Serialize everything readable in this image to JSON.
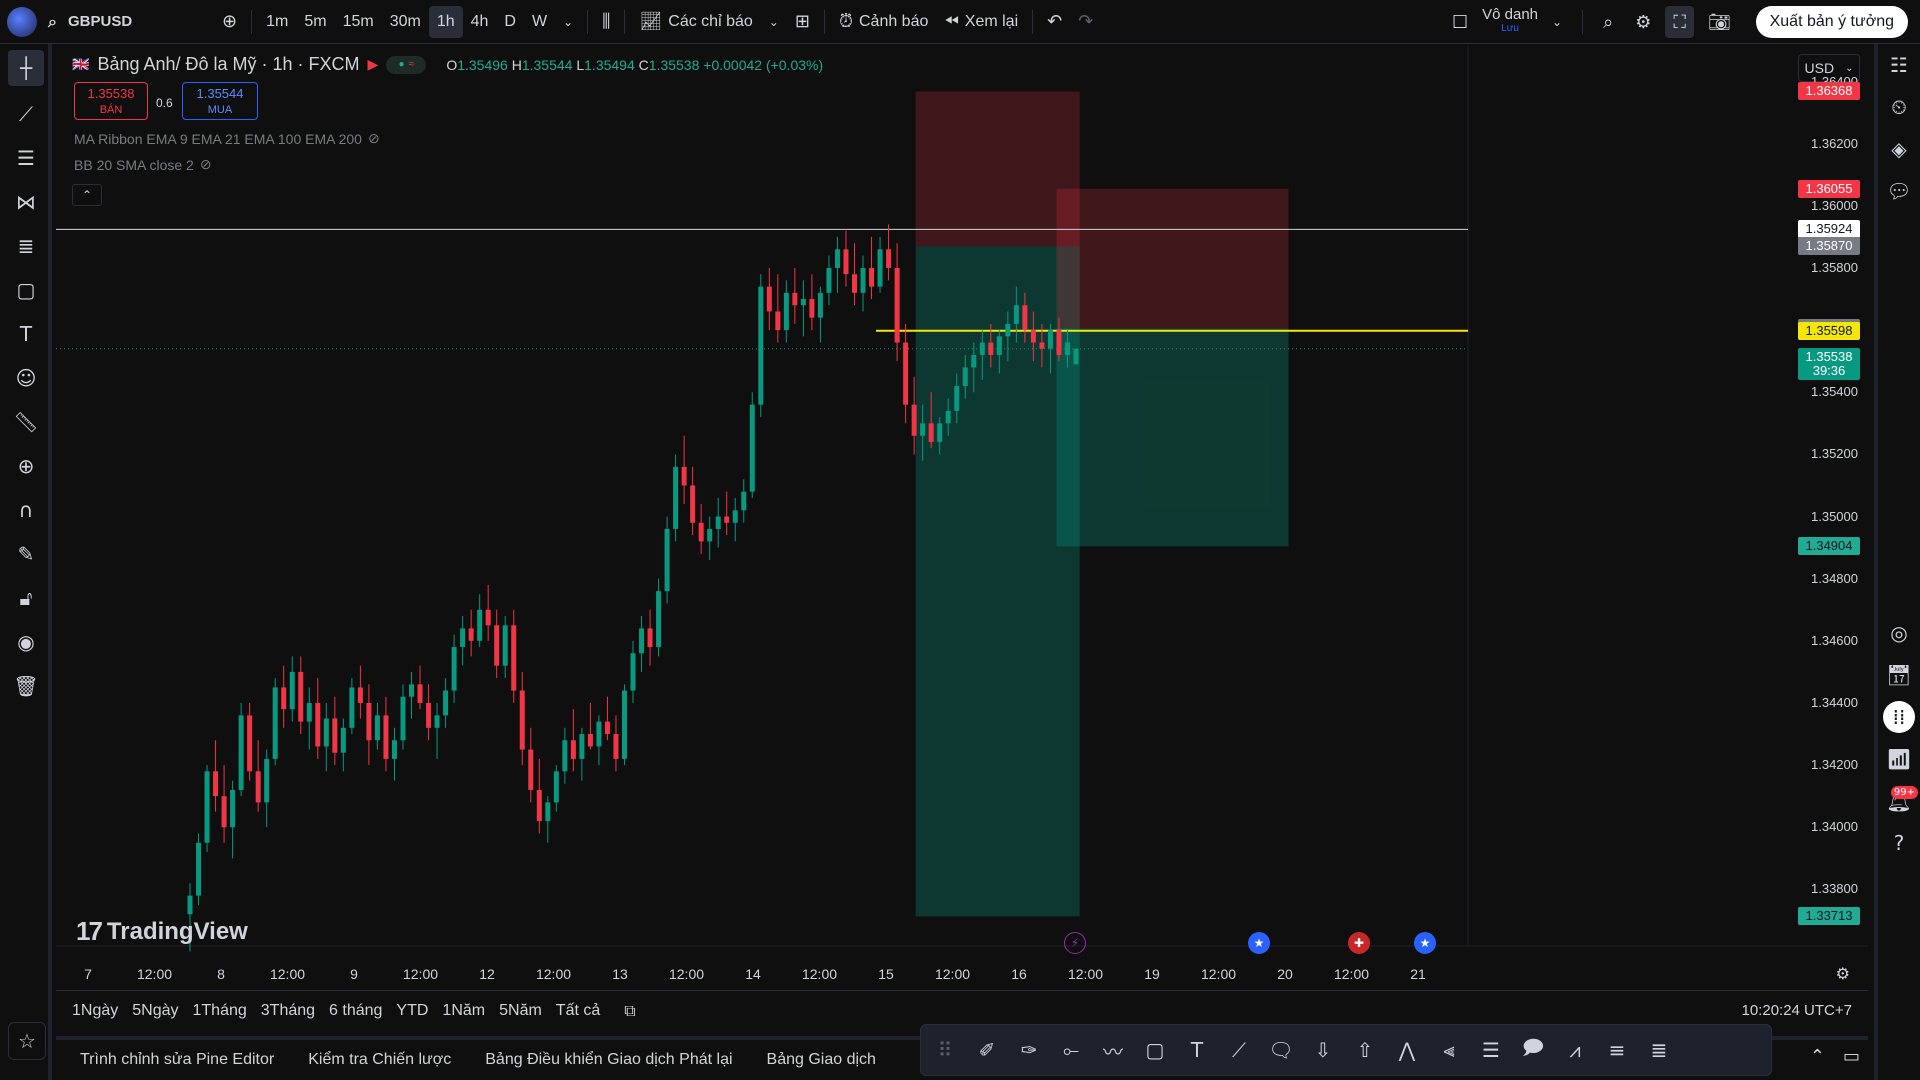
{
  "topbar": {
    "symbol": "GBPUSD",
    "intervals": [
      "1m",
      "5m",
      "15m",
      "30m",
      "1h",
      "4h",
      "D",
      "W"
    ],
    "active_interval": "1h",
    "indicators_label": "Các chỉ báo",
    "alert_label": "Cảnh báo",
    "replay_label": "Xem lại",
    "layout_name": "Vô danh",
    "layout_sub": "Lưu",
    "publish_label": "Xuất bản ý tưởng"
  },
  "legend": {
    "title": "Bảng Anh/ Đô la Mỹ · 1h · FXCM",
    "o_label": "O",
    "o": "1.35496",
    "h_label": "H",
    "h": "1.35544",
    "l_label": "L",
    "l": "1.35494",
    "c_label": "C",
    "c": "1.35538",
    "change": "+0.00042 (+0.03%)",
    "sell_price": "1.35538",
    "sell_label": "BÁN",
    "buy_price": "1.35544",
    "buy_label": "MUA",
    "spread": "0.6",
    "indicator1": "MA Ribbon EMA 9 EMA 21 EMA 100 EMA 200",
    "indicator2": "BB 20 SMA close 2",
    "currency": "USD"
  },
  "price_axis": {
    "ticks": [
      "1.36400",
      "1.36200",
      "1.36000",
      "1.35800",
      "1.35400",
      "1.35200",
      "1.35000",
      "1.34800",
      "1.34600",
      "1.34400",
      "1.34200",
      "1.34000",
      "1.33800"
    ],
    "labels": [
      {
        "text": "1.36368",
        "bg": "#f23645",
        "fg": "#ffffff"
      },
      {
        "text": "1.36055",
        "bg": "#f23645",
        "fg": "#ffffff"
      },
      {
        "text": "1.35924",
        "bg": "#ffffff",
        "fg": "#131722"
      },
      {
        "text": "1.35870",
        "bg": "#787b86",
        "fg": "#ffffff"
      },
      {
        "text": "1.35607",
        "bg": "#787b86",
        "fg": "#ffffff"
      },
      {
        "text": "1.35598",
        "bg": "#f5e60a",
        "fg": "#131722"
      },
      {
        "text": "1.35538",
        "bg": "#089981",
        "fg": "#ffffff"
      },
      {
        "text": "1.34904",
        "bg": "#22ab94",
        "fg": "#131722"
      },
      {
        "text": "1.33713",
        "bg": "#22ab94",
        "fg": "#131722"
      }
    ],
    "countdown": "39:36"
  },
  "time_axis": [
    "7",
    "12:00",
    "8",
    "12:00",
    "9",
    "12:00",
    "12",
    "12:00",
    "13",
    "12:00",
    "14",
    "12:00",
    "15",
    "12:00",
    "16",
    "12:00",
    "19",
    "12:00",
    "20",
    "12:00",
    "21"
  ],
  "ranges": [
    "1Ngày",
    "5Ngày",
    "1Tháng",
    "3Tháng",
    "6 tháng",
    "YTD",
    "1Năm",
    "5Năm",
    "Tất cả"
  ],
  "clock": "10:20:24 UTC+7",
  "bottom_tabs": [
    "Trình chỉnh sửa Pine Editor",
    "Kiểm tra Chiến lược",
    "Bảng Điều khiển Giao dịch Phát lại",
    "Bảng Giao dịch"
  ],
  "watermark": "TradingView",
  "notifications_badge": "99+",
  "colors": {
    "up": "#089981",
    "down": "#f23645",
    "bg": "#0f0f0f",
    "line_yellow": "#f5e60a"
  },
  "chart_data": {
    "type": "candlestick",
    "ylim": [
      1.3365,
      1.3645
    ],
    "x": "bars",
    "candles": [
      [
        1.3372,
        1.3382,
        1.336,
        1.3378
      ],
      [
        1.3378,
        1.3398,
        1.3375,
        1.3395
      ],
      [
        1.3395,
        1.342,
        1.3392,
        1.3418
      ],
      [
        1.3418,
        1.3428,
        1.3405,
        1.341
      ],
      [
        1.341,
        1.342,
        1.3395,
        1.34
      ],
      [
        1.34,
        1.3415,
        1.339,
        1.3412
      ],
      [
        1.3412,
        1.344,
        1.341,
        1.3436
      ],
      [
        1.3436,
        1.344,
        1.3415,
        1.3418
      ],
      [
        1.3418,
        1.3428,
        1.3405,
        1.3408
      ],
      [
        1.3408,
        1.3425,
        1.34,
        1.3422
      ],
      [
        1.3422,
        1.3448,
        1.342,
        1.3445
      ],
      [
        1.3445,
        1.3452,
        1.3432,
        1.3438
      ],
      [
        1.3438,
        1.3455,
        1.3434,
        1.345
      ],
      [
        1.345,
        1.3455,
        1.343,
        1.3434
      ],
      [
        1.3434,
        1.3445,
        1.3425,
        1.344
      ],
      [
        1.344,
        1.3448,
        1.3422,
        1.3426
      ],
      [
        1.3426,
        1.344,
        1.3418,
        1.3435
      ],
      [
        1.3435,
        1.3442,
        1.342,
        1.3424
      ],
      [
        1.3424,
        1.3435,
        1.3418,
        1.3432
      ],
      [
        1.3432,
        1.3448,
        1.343,
        1.3445
      ],
      [
        1.3445,
        1.3452,
        1.3435,
        1.344
      ],
      [
        1.344,
        1.3446,
        1.342,
        1.3428
      ],
      [
        1.3428,
        1.344,
        1.3425,
        1.3436
      ],
      [
        1.3436,
        1.3442,
        1.3418,
        1.3422
      ],
      [
        1.3422,
        1.3432,
        1.3415,
        1.3428
      ],
      [
        1.3428,
        1.3446,
        1.3425,
        1.3442
      ],
      [
        1.3442,
        1.345,
        1.3435,
        1.3446
      ],
      [
        1.3446,
        1.3452,
        1.3438,
        1.344
      ],
      [
        1.344,
        1.3446,
        1.3428,
        1.3432
      ],
      [
        1.3432,
        1.344,
        1.3422,
        1.3436
      ],
      [
        1.3436,
        1.3448,
        1.3432,
        1.3444
      ],
      [
        1.3444,
        1.3462,
        1.344,
        1.3458
      ],
      [
        1.3458,
        1.3468,
        1.3452,
        1.3464
      ],
      [
        1.3464,
        1.347,
        1.3455,
        1.346
      ],
      [
        1.346,
        1.3475,
        1.3458,
        1.347
      ],
      [
        1.347,
        1.3478,
        1.346,
        1.3465
      ],
      [
        1.3465,
        1.347,
        1.3448,
        1.3452
      ],
      [
        1.3452,
        1.3468,
        1.3448,
        1.3465
      ],
      [
        1.3465,
        1.347,
        1.344,
        1.3444
      ],
      [
        1.3444,
        1.345,
        1.342,
        1.3425
      ],
      [
        1.3425,
        1.3432,
        1.3408,
        1.3412
      ],
      [
        1.3412,
        1.3422,
        1.3398,
        1.3402
      ],
      [
        1.3402,
        1.341,
        1.3395,
        1.3408
      ],
      [
        1.3408,
        1.342,
        1.3405,
        1.3418
      ],
      [
        1.3418,
        1.3432,
        1.3414,
        1.3428
      ],
      [
        1.3428,
        1.3438,
        1.3418,
        1.3422
      ],
      [
        1.3422,
        1.3432,
        1.3415,
        1.343
      ],
      [
        1.343,
        1.344,
        1.3425,
        1.3426
      ],
      [
        1.3426,
        1.3436,
        1.342,
        1.3434
      ],
      [
        1.3434,
        1.3442,
        1.3428,
        1.343
      ],
      [
        1.343,
        1.3436,
        1.3418,
        1.3422
      ],
      [
        1.3422,
        1.3446,
        1.342,
        1.3444
      ],
      [
        1.3444,
        1.346,
        1.344,
        1.3456
      ],
      [
        1.3456,
        1.3468,
        1.345,
        1.3464
      ],
      [
        1.3464,
        1.347,
        1.3452,
        1.3458
      ],
      [
        1.3458,
        1.348,
        1.3455,
        1.3476
      ],
      [
        1.3476,
        1.35,
        1.3472,
        1.3496
      ],
      [
        1.3496,
        1.352,
        1.3492,
        1.3516
      ],
      [
        1.3516,
        1.3526,
        1.3504,
        1.351
      ],
      [
        1.351,
        1.3516,
        1.3494,
        1.3498
      ],
      [
        1.3498,
        1.3504,
        1.3488,
        1.3492
      ],
      [
        1.3492,
        1.35,
        1.3486,
        1.3496
      ],
      [
        1.3496,
        1.3506,
        1.349,
        1.35
      ],
      [
        1.35,
        1.3508,
        1.3494,
        1.3498
      ],
      [
        1.3498,
        1.3506,
        1.3492,
        1.3502
      ],
      [
        1.3502,
        1.3512,
        1.3498,
        1.3508
      ],
      [
        1.3508,
        1.354,
        1.3506,
        1.3536
      ],
      [
        1.3536,
        1.3578,
        1.3532,
        1.3574
      ],
      [
        1.3574,
        1.358,
        1.356,
        1.3566
      ],
      [
        1.3566,
        1.3578,
        1.3556,
        1.356
      ],
      [
        1.356,
        1.3576,
        1.3556,
        1.3572
      ],
      [
        1.3572,
        1.358,
        1.3562,
        1.3568
      ],
      [
        1.3568,
        1.3576,
        1.3558,
        1.357
      ],
      [
        1.357,
        1.3578,
        1.356,
        1.3564
      ],
      [
        1.3564,
        1.3574,
        1.3556,
        1.3572
      ],
      [
        1.3572,
        1.3584,
        1.3568,
        1.358
      ],
      [
        1.358,
        1.359,
        1.3572,
        1.3586
      ],
      [
        1.3586,
        1.3592,
        1.3574,
        1.3578
      ],
      [
        1.3578,
        1.3588,
        1.3568,
        1.3572
      ],
      [
        1.3572,
        1.3584,
        1.3566,
        1.358
      ],
      [
        1.358,
        1.359,
        1.357,
        1.3574
      ],
      [
        1.3574,
        1.359,
        1.3572,
        1.3586
      ],
      [
        1.3586,
        1.3594,
        1.3576,
        1.358
      ],
      [
        1.358,
        1.3588,
        1.355,
        1.3556
      ],
      [
        1.3556,
        1.3562,
        1.353,
        1.3536
      ],
      [
        1.3536,
        1.3545,
        1.352,
        1.3526
      ],
      [
        1.3526,
        1.3536,
        1.3518,
        1.353
      ],
      [
        1.353,
        1.354,
        1.3522,
        1.3524
      ],
      [
        1.3524,
        1.3532,
        1.352,
        1.353
      ],
      [
        1.353,
        1.3538,
        1.3526,
        1.3534
      ],
      [
        1.3534,
        1.3546,
        1.353,
        1.3542
      ],
      [
        1.3542,
        1.3552,
        1.3538,
        1.3548
      ],
      [
        1.3548,
        1.3556,
        1.354,
        1.3552
      ],
      [
        1.3552,
        1.356,
        1.3544,
        1.3556
      ],
      [
        1.3556,
        1.3562,
        1.3548,
        1.3552
      ],
      [
        1.3552,
        1.356,
        1.3546,
        1.3558
      ],
      [
        1.3558,
        1.3566,
        1.355,
        1.3562
      ],
      [
        1.3562,
        1.3574,
        1.3556,
        1.3568
      ],
      [
        1.3568,
        1.3572,
        1.3556,
        1.356
      ],
      [
        1.356,
        1.3566,
        1.355,
        1.3556
      ],
      [
        1.3556,
        1.3562,
        1.3548,
        1.3554
      ],
      [
        1.3554,
        1.3562,
        1.3546,
        1.356
      ],
      [
        1.356,
        1.3564,
        1.355,
        1.3552
      ],
      [
        1.3552,
        1.356,
        1.3548,
        1.3556
      ],
      [
        1.3549,
        1.3554,
        1.3549,
        1.3554
      ]
    ],
    "horizontal_lines": [
      1.35924,
      1.35598
    ],
    "positions": [
      {
        "entry": 1.3587,
        "stop": 1.36368,
        "target": 1.33713
      },
      {
        "entry": 1.35607,
        "stop": 1.36055,
        "target": 1.34904
      }
    ]
  }
}
